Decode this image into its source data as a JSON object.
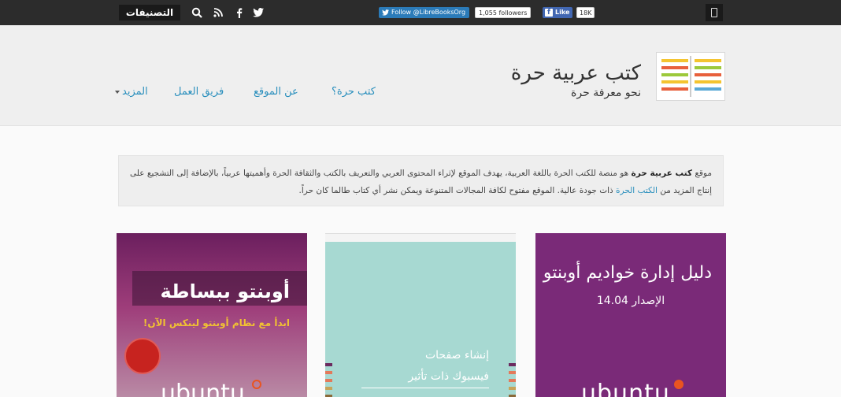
{
  "topbar": {
    "categories_label": "التصنيفات",
    "twitter_follow": "Follow @LibreBooksOrg",
    "twitter_followers": "1,055 followers",
    "fb_like": "Like",
    "fb_count": "18K",
    "icons": [
      "search-icon",
      "rss-icon",
      "facebook-icon",
      "twitter-icon",
      "mobile-icon"
    ]
  },
  "site": {
    "title": "كتب عربية حرة",
    "tagline": "نحو معرفة حرة"
  },
  "nav": {
    "items": [
      "كتب حرة؟",
      "عن الموقع",
      "فريق العمل",
      "المزيد"
    ]
  },
  "intro": {
    "lead": "موقع",
    "brand": "كتب عربية حرة",
    "part1": "هو منصة للكتب الحرة باللغة العربية، يهدف الموقع لإثراء المحتوى العربي والتعريف بالكتب والثقافة الحرة وأهميتها عربياً، بالإضافة إلى التشجيع على إنتاج المزيد من",
    "link": "الكتب الحرة",
    "part2": "ذات جودة عالية. الموقع مفتوح لكافة المجالات المتنوعة ويمكن نشر أي كتاب طالما كان حراً."
  },
  "books": [
    {
      "title": "دليل إدارة خواديم أوبنتو",
      "subtitle": "الإصدار 14.04",
      "brand": "ubuntu"
    },
    {
      "title": "إنشاء صفحات",
      "subtitle": "فيسبوك ذات تأثير"
    },
    {
      "title": "أوبنتو ببساطة",
      "subtitle": "ابدأ مع نظام أوبنتو لينكس الآن!",
      "brand": "ubuntu"
    }
  ],
  "colors": {
    "topbar": "#2c2c2c",
    "link": "#2a8fbd",
    "book1": "#7a2a78",
    "book2": "#a7d9d2",
    "book3": "#9e3d7a"
  }
}
